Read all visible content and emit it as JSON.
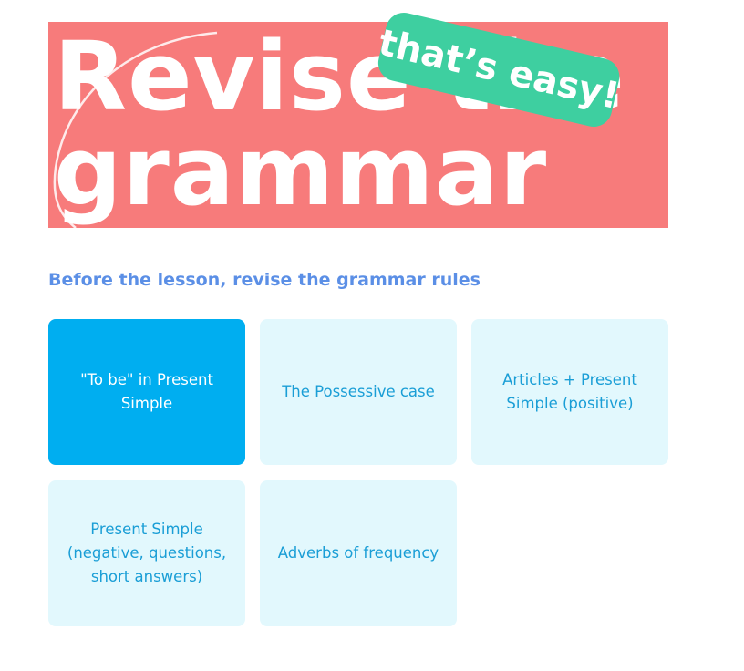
{
  "banner": {
    "line1": "Revise the",
    "line2": "grammar",
    "sticker": "that’s easy!",
    "background": "#f77b7b",
    "sticker_color": "#3ecfa0"
  },
  "subtitle": "Before the lesson, revise the grammar rules",
  "cards": [
    {
      "label": "\"To be\" in Present Simple",
      "active": true
    },
    {
      "label": "The Possessive case",
      "active": false
    },
    {
      "label": "Articles + Present Simple (positive)",
      "active": false
    },
    {
      "label": "Present Simple (negative, questions, short answers)",
      "active": false
    },
    {
      "label": "Adverbs of frequency",
      "active": false
    }
  ],
  "colors": {
    "accent": "#00aef0",
    "card_bg": "#e2f8fd",
    "card_text": "#1a9ed6",
    "subtitle": "#5b8fe6"
  }
}
